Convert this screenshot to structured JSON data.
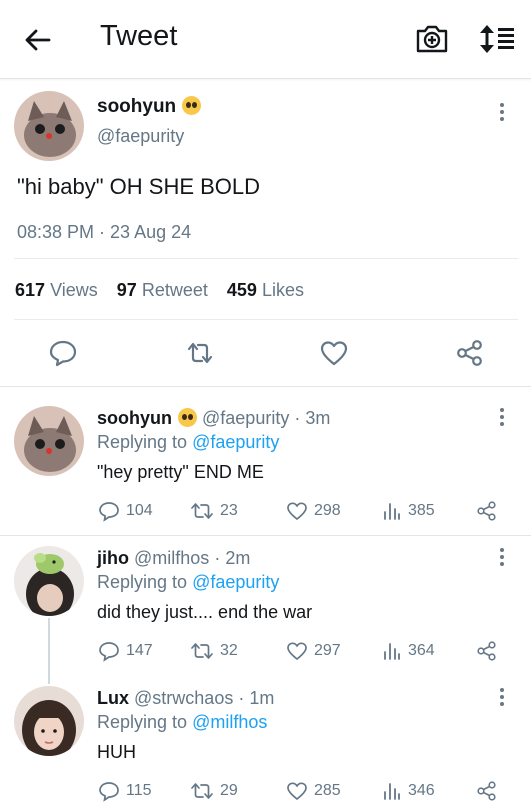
{
  "header": {
    "title": "Tweet",
    "back_icon": "arrow-left-icon",
    "camera_icon": "camera-plus-icon",
    "sort_icon": "sort-icon"
  },
  "main_tweet": {
    "name": "soohyun",
    "handle": "@faepurity",
    "text": "\"hi baby\" OH SHE BOLD",
    "time": "08:38 PM · 23 Aug 24",
    "views_count": "617",
    "views_label": "Views",
    "retweet_count": "97",
    "retweet_label": "Retweet",
    "likes_count": "459",
    "likes_label": "Likes"
  },
  "replies": [
    {
      "name": "soohyun",
      "handle": "@faepurity",
      "time": "· 3m",
      "replying_prefix": "Replying to",
      "replying_to": "@faepurity",
      "text": "\"hey pretty\" END ME",
      "replies": "104",
      "retweets": "23",
      "likes": "298",
      "views": "385"
    },
    {
      "name": "jiho",
      "handle": "@milfhos",
      "time": "· 2m",
      "replying_prefix": "Replying to",
      "replying_to": "@faepurity",
      "text": "did they just.... end the war",
      "replies": "147",
      "retweets": "32",
      "likes": "297",
      "views": "364"
    },
    {
      "name": "Lux",
      "handle": "@strwchaos",
      "time": "· 1m",
      "replying_prefix": "Replying to",
      "replying_to": "@milfhos",
      "text": "HUH",
      "replies": "115",
      "retweets": "29",
      "likes": "285",
      "views": "346"
    }
  ],
  "colors": {
    "link": "#1da1f2",
    "muted": "#657786",
    "divider": "#e1e6ea"
  }
}
